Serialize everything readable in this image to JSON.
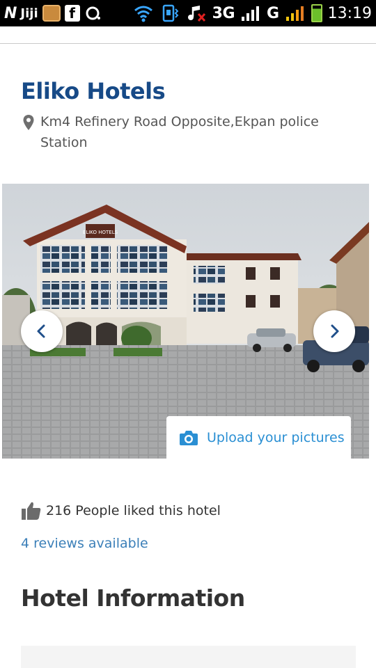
{
  "status_bar": {
    "n_icon": "N",
    "jiji_label": "Jiji",
    "fb_label": "f",
    "network_3g": "3G",
    "network_g": "G",
    "time": "13:19"
  },
  "hotel": {
    "name": "Eliko Hotels",
    "address": "Km4 Refinery Road Opposite,Ekpan police Station",
    "upload_label": "Upload your pictures",
    "likes_text": "216 People liked this hotel",
    "reviews_link": "4 reviews available",
    "sign_text": "ELIKO HOTELS"
  },
  "sections": {
    "info_title": "Hotel Information"
  },
  "colors": {
    "title": "#174a87",
    "link": "#3b7fb8",
    "upload": "#2a8fd3"
  }
}
